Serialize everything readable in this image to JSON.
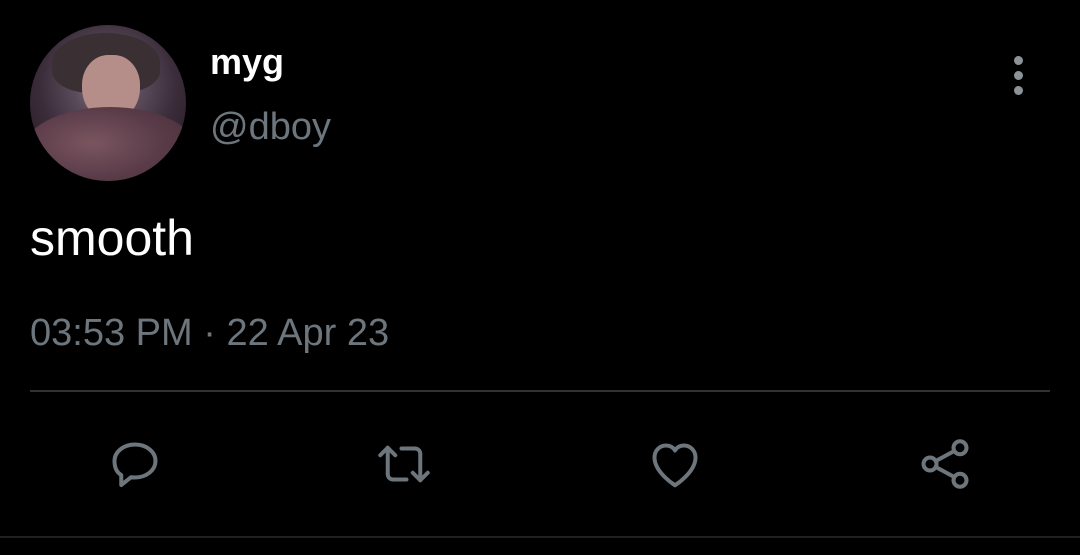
{
  "tweet": {
    "display_name": "myg",
    "handle": "@dboy",
    "text": "smooth",
    "time": "03:53 PM",
    "separator": "·",
    "date": "22 Apr 23"
  },
  "icons": {
    "more": "more-vertical-icon",
    "reply": "reply-icon",
    "retweet": "retweet-icon",
    "like": "heart-icon",
    "share": "share-icon"
  },
  "colors": {
    "background": "#000000",
    "primary_text": "#ffffff",
    "secondary_text": "#6e767d",
    "icon": "#6e767d",
    "divider": "#2f3336"
  }
}
